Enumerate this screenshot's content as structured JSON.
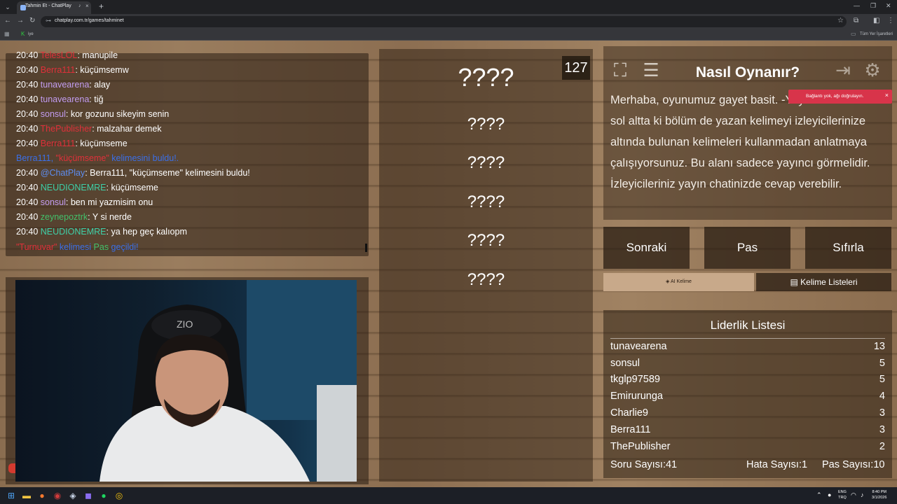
{
  "browser": {
    "tab_title": "Tahmin Et - ChatPlay",
    "url": "chatplay.com.tr/games/tahminet",
    "bookmarks_all_label": "Tüm Yer İşaretleri",
    "bookmark_first_label": "iye"
  },
  "chat": {
    "messages": [
      {
        "time": "20:40",
        "user": "TelesLOL",
        "text": ": manupile",
        "user_color": "#e0303a"
      },
      {
        "time": "20:40",
        "user": "Berra111",
        "text": ": küçümsemw",
        "user_color": "#e0303a"
      },
      {
        "time": "20:40",
        "user": "tunavearena",
        "text": ": alay",
        "user_color": "#c29cf0"
      },
      {
        "time": "20:40",
        "user": "tunavearena",
        "text": ": tiğ",
        "user_color": "#c29cf0"
      },
      {
        "time": "20:40",
        "user": "sonsul",
        "text": ": kor gozunu sikeyim senin",
        "user_color": "#c29cf0"
      },
      {
        "time": "20:40",
        "user": "ThePublisher",
        "text": ": malzahar demek",
        "user_color": "#e0303a"
      },
      {
        "time": "20:40",
        "user": "Berra111",
        "text": ": küçümseme",
        "user_color": "#e0303a"
      }
    ],
    "found_line": {
      "user": "Berra111",
      "word": "\"küçümseme\"",
      "rest": " kelimesini buldu!."
    },
    "bot_line": {
      "time": "20:40",
      "user": "@ChatPlay",
      "text": ": Berra111, \"küçümseme\" kelimesini buldu!"
    },
    "messages2": [
      {
        "time": "20:40",
        "user": "NEUDIONEMRE",
        "text": ": küçümseme",
        "user_color": "#3fd0a8"
      },
      {
        "time": "20:40",
        "user": "sonsul",
        "text": ": ben mi yazmisim onu",
        "user_color": "#c29cf0"
      },
      {
        "time": "20:40",
        "user": "zeynepoztrk",
        "text": ": Y si nerde",
        "user_color": "#43c06a"
      },
      {
        "time": "20:40",
        "user": "NEUDIONEMRE",
        "text": ": ya hep geç kalıopm",
        "user_color": "#3fd0a8"
      }
    ],
    "pass_line": {
      "word": "\"Turnuvar\"",
      "mid": " kelimesi ",
      "pas": "Pas",
      "end": " geçildi!"
    }
  },
  "words": {
    "counter": "127",
    "items": [
      "????",
      "????",
      "????",
      "????",
      "????",
      "????"
    ]
  },
  "howto": {
    "title": "Nasıl Oynanır?",
    "body": "Merhaba, oyunumuz gayet basit. -Yayıncı Alanı- olan sol altta ki bölüm de yazan kelimeyi izleyicilerinize altında bulunan kelimeleri kullanmadan anlatmaya çalışıyorsunuz. Bu alanı sadece yayıncı görmelidir. İzleyicileriniz yayın chatinizde cevap verebilir."
  },
  "toast": {
    "text": "Bağlantı yok, ağı doğrulayın.",
    "bg": "#d8344a"
  },
  "buttons": {
    "next": "Sonraki",
    "pass": "Pas",
    "reset": "Sıfırla",
    "ai_word": "AI Kelime",
    "word_lists": "Kelime Listeleri"
  },
  "leaderboard": {
    "title": "Liderlik Listesi",
    "rows": [
      {
        "name": "tunavearena",
        "score": "13"
      },
      {
        "name": "sonsul",
        "score": "5"
      },
      {
        "name": "tkglp97589",
        "score": "5"
      },
      {
        "name": "Emirurunga",
        "score": "4"
      },
      {
        "name": "Charlie9",
        "score": "3"
      },
      {
        "name": "Berra111",
        "score": "3"
      },
      {
        "name": "ThePublisher",
        "score": "2"
      }
    ],
    "questions": "Soru Sayısı:41",
    "errors": "Hata Sayısı:1",
    "passes": "Pas Sayısı:10"
  },
  "taskbar": {
    "lang": "ENG",
    "region": "TRQ",
    "time": "8:40 PM",
    "date": "3/1/2026"
  }
}
